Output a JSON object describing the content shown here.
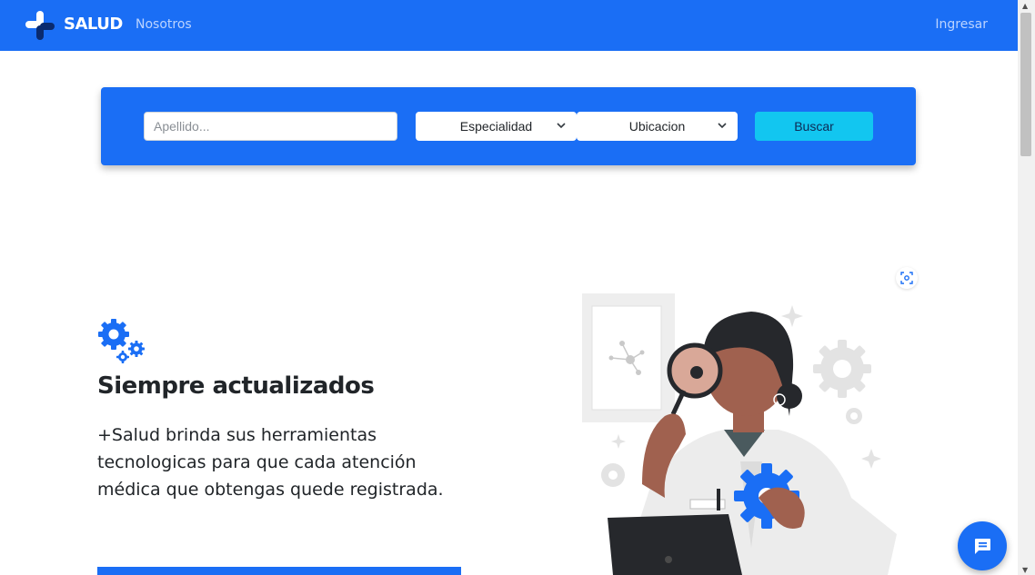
{
  "navbar": {
    "brand": "SALUD",
    "links": [
      "Nosotros"
    ],
    "login": "Ingresar"
  },
  "search": {
    "apellido_placeholder": "Apellido...",
    "especialidad": "Especialidad",
    "ubicacion": "Ubicacion",
    "button": "Buscar"
  },
  "feature": {
    "title": "Siempre actualizados",
    "text": "+Salud brinda sus herramientas tecnologicas para que cada atención médica que obtengas quede registrada."
  },
  "icons": {
    "brand": "plus-cross-logo",
    "feature": "gears-icon",
    "select": "chevron-down-icon",
    "focus": "screenshot-focus-icon",
    "chat": "chat-message-icon"
  },
  "colors": {
    "primary": "#1a6ef5",
    "button": "#12c6f0",
    "text": "#212529"
  }
}
